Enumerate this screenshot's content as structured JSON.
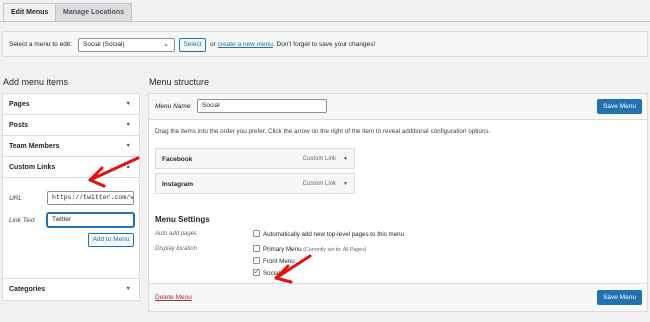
{
  "tabs": [
    {
      "label": "Edit Menus"
    },
    {
      "label": "Manage Locations"
    }
  ],
  "select_bar": {
    "label": "Select a menu to edit:",
    "selected_menu": "Social (Social)",
    "select_button": "Select",
    "or_text": "or",
    "create_link": "create a new menu",
    "suffix_text": ". Don't forget to save your changes!"
  },
  "left": {
    "heading": "Add menu items",
    "sections": [
      "Pages",
      "Posts",
      "Team Members",
      "Custom Links",
      "Categories"
    ],
    "custom_links": {
      "url_label": "URL",
      "url_value": "https://twitter.com/v",
      "link_text_label": "Link Text",
      "link_text_value": "Twitter",
      "add_button": "Add to Menu"
    }
  },
  "right": {
    "heading": "Menu structure",
    "menu_name_label": "Menu Name",
    "menu_name_value": "Social",
    "save_button": "Save Menu",
    "instructions": "Drag the items into the order you prefer. Click the arrow on the right of the item to reveal additional configuration options.",
    "items": [
      {
        "title": "Facebook",
        "type": "Custom Link"
      },
      {
        "title": "Instagram",
        "type": "Custom Link"
      }
    ],
    "settings": {
      "heading": "Menu Settings",
      "auto_add_label": "Auto add pages",
      "auto_add_option": "Automatically add new top-level pages to this menu",
      "display_location_label": "Display location",
      "locations": [
        {
          "label": "Primary Menu",
          "note": "(Currently set to: All Pages)",
          "checked": false
        },
        {
          "label": "Front Menu",
          "note": "",
          "checked": false
        },
        {
          "label": "Social",
          "note": "",
          "checked": true
        }
      ]
    },
    "delete_link": "Delete Menu"
  },
  "colors": {
    "accent": "#2271b1",
    "annotation_arrow": "#e3120b",
    "delete": "#b32d2e"
  }
}
